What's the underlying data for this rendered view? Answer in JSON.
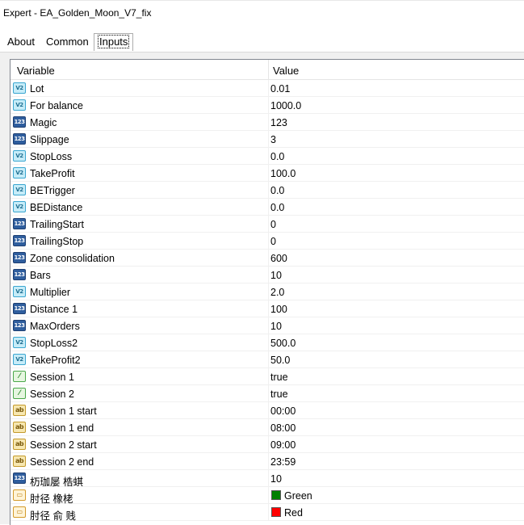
{
  "window": {
    "title": "Expert - EA_Golden_Moon_V7_fix"
  },
  "tabs": [
    {
      "label": "About"
    },
    {
      "label": "Common"
    },
    {
      "label": "Inputs"
    }
  ],
  "table": {
    "headers": {
      "variable": "Variable",
      "value": "Value"
    },
    "rows": [
      {
        "icon": "double-icon",
        "name": "Lot",
        "value": "0.01"
      },
      {
        "icon": "double-icon",
        "name": "For balance",
        "value": "1000.0"
      },
      {
        "icon": "integer-icon",
        "name": "Magic",
        "value": "123"
      },
      {
        "icon": "integer-icon",
        "name": "Slippage",
        "value": "3"
      },
      {
        "icon": "double-icon",
        "name": "StopLoss",
        "value": "0.0"
      },
      {
        "icon": "double-icon",
        "name": "TakeProfit",
        "value": "100.0"
      },
      {
        "icon": "double-icon",
        "name": "BETrigger",
        "value": "0.0"
      },
      {
        "icon": "double-icon",
        "name": "BEDistance",
        "value": "0.0"
      },
      {
        "icon": "integer-icon",
        "name": "TrailingStart",
        "value": "0"
      },
      {
        "icon": "integer-icon",
        "name": "TrailingStop",
        "value": "0"
      },
      {
        "icon": "integer-icon",
        "name": "Zone consolidation",
        "value": "600"
      },
      {
        "icon": "integer-icon",
        "name": "Bars",
        "value": "10"
      },
      {
        "icon": "double-icon",
        "name": "Multiplier",
        "value": "2.0"
      },
      {
        "icon": "integer-icon",
        "name": "Distance 1",
        "value": "100"
      },
      {
        "icon": "integer-icon",
        "name": "MaxOrders",
        "value": "10"
      },
      {
        "icon": "double-icon",
        "name": "StopLoss2",
        "value": "500.0"
      },
      {
        "icon": "double-icon",
        "name": "TakeProfit2",
        "value": "50.0"
      },
      {
        "icon": "bool-icon",
        "name": "Session 1",
        "value": "true"
      },
      {
        "icon": "bool-icon",
        "name": "Session 2",
        "value": "true"
      },
      {
        "icon": "string-icon",
        "name": "Session 1 start",
        "value": "00:00"
      },
      {
        "icon": "string-icon",
        "name": "Session 1 end",
        "value": "08:00"
      },
      {
        "icon": "string-icon",
        "name": "Session 2 start",
        "value": "09:00"
      },
      {
        "icon": "string-icon",
        "name": "Session 2 end",
        "value": "23:59"
      },
      {
        "icon": "integer-icon",
        "name": "杤珈屡  梏蜞",
        "value": "10"
      },
      {
        "icon": "color-icon",
        "name": "肘径 橡栳",
        "value": "Green",
        "color": "#008000"
      },
      {
        "icon": "color-icon",
        "name": "肘径 俞  贱",
        "value": "Red",
        "color": "#ff0000"
      }
    ]
  }
}
